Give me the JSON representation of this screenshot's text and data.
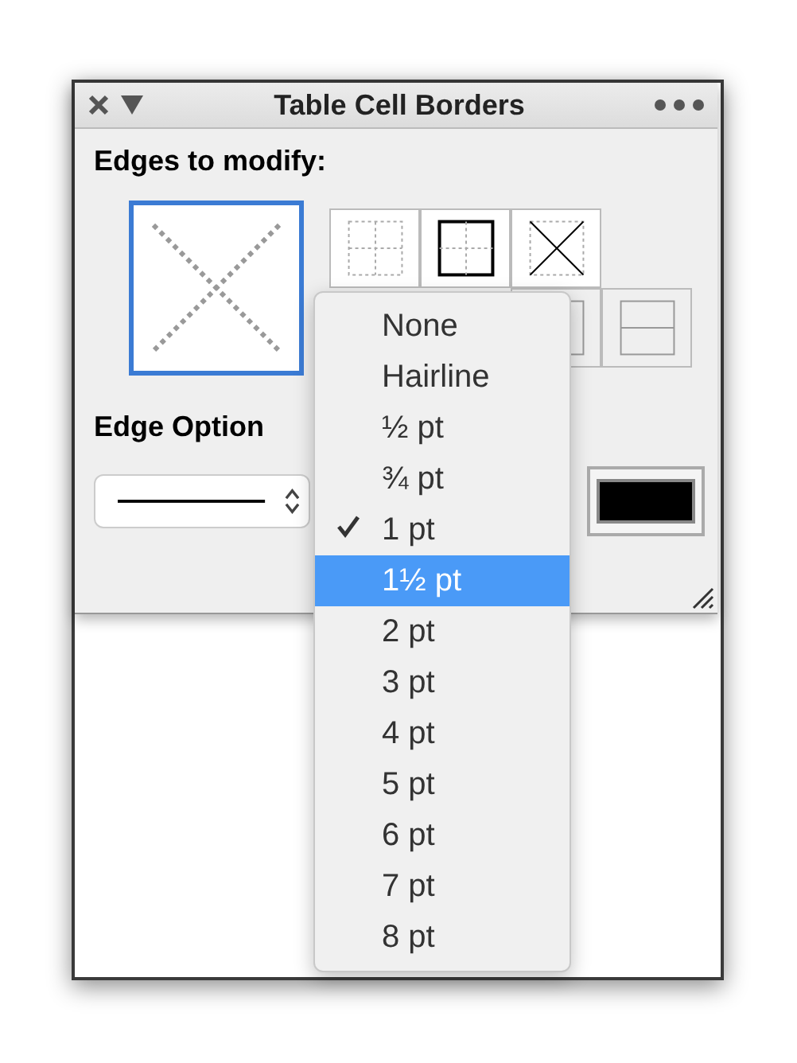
{
  "window": {
    "title": "Table Cell Borders"
  },
  "edges_heading": "Edges to modify:",
  "edge_buttons": [
    {
      "kind": "all",
      "selected": true
    }
  ],
  "edge_grid": [
    [
      {
        "kind": "none",
        "selected": false
      },
      {
        "kind": "outer",
        "selected": false
      },
      {
        "kind": "diagonal",
        "selected": false
      }
    ],
    [
      {
        "kind": "vertical",
        "selected": false
      },
      {
        "kind": "horizontal",
        "selected": false
      }
    ]
  ],
  "options_heading": "Edge Option",
  "color_well": {
    "color": "#000000"
  },
  "menu": [
    {
      "label": "None",
      "checked": false,
      "selected": false
    },
    {
      "label": "Hairline",
      "checked": false,
      "selected": false
    },
    {
      "label": "½ pt",
      "checked": false,
      "selected": false
    },
    {
      "label": "¾ pt",
      "checked": false,
      "selected": false
    },
    {
      "label": "1 pt",
      "checked": true,
      "selected": false
    },
    {
      "label": "1½ pt",
      "checked": false,
      "selected": true
    },
    {
      "label": "2 pt",
      "checked": false,
      "selected": false
    },
    {
      "label": "3 pt",
      "checked": false,
      "selected": false
    },
    {
      "label": "4 pt",
      "checked": false,
      "selected": false
    },
    {
      "label": "5 pt",
      "checked": false,
      "selected": false
    },
    {
      "label": "6 pt",
      "checked": false,
      "selected": false
    },
    {
      "label": "7 pt",
      "checked": false,
      "selected": false
    },
    {
      "label": "8 pt",
      "checked": false,
      "selected": false
    }
  ]
}
